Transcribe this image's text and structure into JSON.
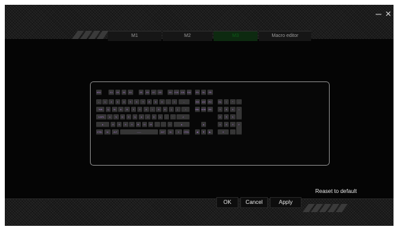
{
  "window": {
    "minimize_label": "–",
    "close_label": "×"
  },
  "tabs": [
    {
      "label": "M1",
      "active": false
    },
    {
      "label": "M2",
      "active": false
    },
    {
      "label": "M3",
      "active": true
    },
    {
      "label": "Macro editor",
      "active": false
    }
  ],
  "eject_icon": "eject-icon",
  "keyboard": {
    "keys": [
      {
        "id": "esc",
        "label": "ESC"
      },
      {
        "id": "f1",
        "label": "F1"
      },
      {
        "id": "f2",
        "label": "F2"
      },
      {
        "id": "f3",
        "label": "F3"
      },
      {
        "id": "f4",
        "label": "F4"
      },
      {
        "id": "f5",
        "label": "F5"
      },
      {
        "id": "f6",
        "label": "F6"
      },
      {
        "id": "f7",
        "label": "F7"
      },
      {
        "id": "f8",
        "label": "F8"
      },
      {
        "id": "f9",
        "label": "F9"
      },
      {
        "id": "f10",
        "label": "F10"
      },
      {
        "id": "f11",
        "label": "F11"
      },
      {
        "id": "f12",
        "label": "F12"
      },
      {
        "id": "prt",
        "label": "PS"
      },
      {
        "id": "scr",
        "label": "SL"
      },
      {
        "id": "pau",
        "label": "PB"
      },
      {
        "id": "grave",
        "label": "~"
      },
      {
        "id": "1",
        "label": "1"
      },
      {
        "id": "2",
        "label": "2"
      },
      {
        "id": "3",
        "label": "3"
      },
      {
        "id": "4",
        "label": "4"
      },
      {
        "id": "5",
        "label": "5"
      },
      {
        "id": "6",
        "label": "6"
      },
      {
        "id": "7",
        "label": "7"
      },
      {
        "id": "8",
        "label": "8"
      },
      {
        "id": "9",
        "label": "9"
      },
      {
        "id": "0",
        "label": "0"
      },
      {
        "id": "minus",
        "label": "-"
      },
      {
        "id": "equal",
        "label": "="
      },
      {
        "id": "bksp",
        "label": "←"
      },
      {
        "id": "ins",
        "label": "INS"
      },
      {
        "id": "home",
        "label": "HM"
      },
      {
        "id": "pgup",
        "label": "PU"
      },
      {
        "id": "num",
        "label": "NL"
      },
      {
        "id": "ndiv",
        "label": "/"
      },
      {
        "id": "nmul",
        "label": "*"
      },
      {
        "id": "nsub",
        "label": "-"
      },
      {
        "id": "tab",
        "label": "TAB"
      },
      {
        "id": "q",
        "label": "Q"
      },
      {
        "id": "w",
        "label": "W"
      },
      {
        "id": "e",
        "label": "E"
      },
      {
        "id": "r",
        "label": "R"
      },
      {
        "id": "t",
        "label": "T"
      },
      {
        "id": "y",
        "label": "Y"
      },
      {
        "id": "u",
        "label": "U"
      },
      {
        "id": "i",
        "label": "I"
      },
      {
        "id": "o",
        "label": "O"
      },
      {
        "id": "p",
        "label": "P"
      },
      {
        "id": "lbr",
        "label": "["
      },
      {
        "id": "rbr",
        "label": "]"
      },
      {
        "id": "bsl",
        "label": "\\"
      },
      {
        "id": "del",
        "label": "DEL"
      },
      {
        "id": "end",
        "label": "END"
      },
      {
        "id": "pgdn",
        "label": "PD"
      },
      {
        "id": "n7",
        "label": "7"
      },
      {
        "id": "n8",
        "label": "8"
      },
      {
        "id": "n9",
        "label": "9"
      },
      {
        "id": "nadd",
        "label": "+"
      },
      {
        "id": "caps",
        "label": "CAPS"
      },
      {
        "id": "a",
        "label": "A"
      },
      {
        "id": "s",
        "label": "S"
      },
      {
        "id": "d",
        "label": "D"
      },
      {
        "id": "f",
        "label": "F"
      },
      {
        "id": "g",
        "label": "G"
      },
      {
        "id": "h",
        "label": "H"
      },
      {
        "id": "j",
        "label": "J"
      },
      {
        "id": "k",
        "label": "K"
      },
      {
        "id": "l",
        "label": "L"
      },
      {
        "id": "semi",
        "label": ";"
      },
      {
        "id": "quote",
        "label": "'"
      },
      {
        "id": "enter",
        "label": "↵"
      },
      {
        "id": "n4",
        "label": "4"
      },
      {
        "id": "n5",
        "label": "5"
      },
      {
        "id": "n6",
        "label": "6"
      },
      {
        "id": "lshift",
        "label": "▲"
      },
      {
        "id": "z",
        "label": "Z"
      },
      {
        "id": "x",
        "label": "X"
      },
      {
        "id": "c",
        "label": "C"
      },
      {
        "id": "v",
        "label": "V"
      },
      {
        "id": "b",
        "label": "B"
      },
      {
        "id": "n",
        "label": "N"
      },
      {
        "id": "m",
        "label": "M"
      },
      {
        "id": "comma",
        "label": ","
      },
      {
        "id": "period",
        "label": "."
      },
      {
        "id": "slash",
        "label": "/"
      },
      {
        "id": "rshift",
        "label": "▲"
      },
      {
        "id": "up",
        "label": "▲"
      },
      {
        "id": "n1",
        "label": "1"
      },
      {
        "id": "n2",
        "label": "2"
      },
      {
        "id": "n3",
        "label": "3"
      },
      {
        "id": "nent",
        "label": "↵"
      },
      {
        "id": "lctrl",
        "label": "CTRL"
      },
      {
        "id": "lwin",
        "label": "⊞"
      },
      {
        "id": "lalt",
        "label": "ALT"
      },
      {
        "id": "space",
        "label": "——"
      },
      {
        "id": "ralt",
        "label": "ALT"
      },
      {
        "id": "fn",
        "label": "Fn"
      },
      {
        "id": "menu",
        "label": "≡"
      },
      {
        "id": "rctrl",
        "label": "CTRL"
      },
      {
        "id": "left",
        "label": "◀"
      },
      {
        "id": "down",
        "label": "▼"
      },
      {
        "id": "right",
        "label": "▶"
      },
      {
        "id": "n0",
        "label": "0"
      },
      {
        "id": "ndot",
        "label": "."
      }
    ]
  },
  "reset_label": "Reaset to default",
  "buttons": {
    "ok": "OK",
    "cancel": "Cancel",
    "apply": "Apply"
  }
}
